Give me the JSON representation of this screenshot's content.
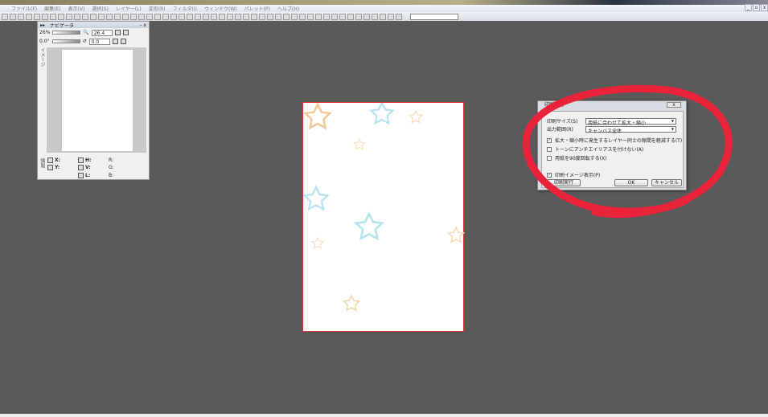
{
  "menu": [
    "ファイル(F)",
    "編集(E)",
    "表示(V)",
    "選択(S)",
    "レイヤー(L)",
    "変形(R)",
    "フィルタ(I)",
    "ウィンドウ(W)",
    "パレット(P)",
    "ヘルプ(H)"
  ],
  "window_buttons": [
    "_",
    "▫",
    "x"
  ],
  "navigator": {
    "tab_icon": "▸▸",
    "title": "ナビゲータ",
    "close": "– x",
    "zoom": "26.4",
    "rotate": "0.0",
    "zoom_label": "26%",
    "rotate_label": "0.0°",
    "side_tab": "イメージ",
    "info_tab": "情報",
    "info": {
      "x": "X:",
      "y": "Y:",
      "h": "H:",
      "v": "V:",
      "l": "L:",
      "r": "R:",
      "g": "G:",
      "b": "B:"
    }
  },
  "dialog": {
    "title": "印刷設定",
    "close": "x",
    "print_size_label": "印刷サイズ(S)",
    "print_size_value": "用紙に合わせて拡大・縮小",
    "output_range_label": "出力範囲(R)",
    "output_range_value": "キャンバス全体",
    "checkboxes": [
      {
        "label": "拡大・縮小時に発生するレイヤー同士の隙間を軽減する(T)",
        "checked": true
      },
      {
        "label": "トーンにアンチエイリアスを付けない(A)",
        "checked": false
      },
      {
        "label": "用紙を90度回転する(X)",
        "checked": false
      },
      {
        "label": "印刷イメージ表示(P)",
        "checked": true
      }
    ],
    "print_button": "印刷実行",
    "ok_button": "OK",
    "cancel_button": "キャンセル"
  },
  "accent": "#e8233a"
}
